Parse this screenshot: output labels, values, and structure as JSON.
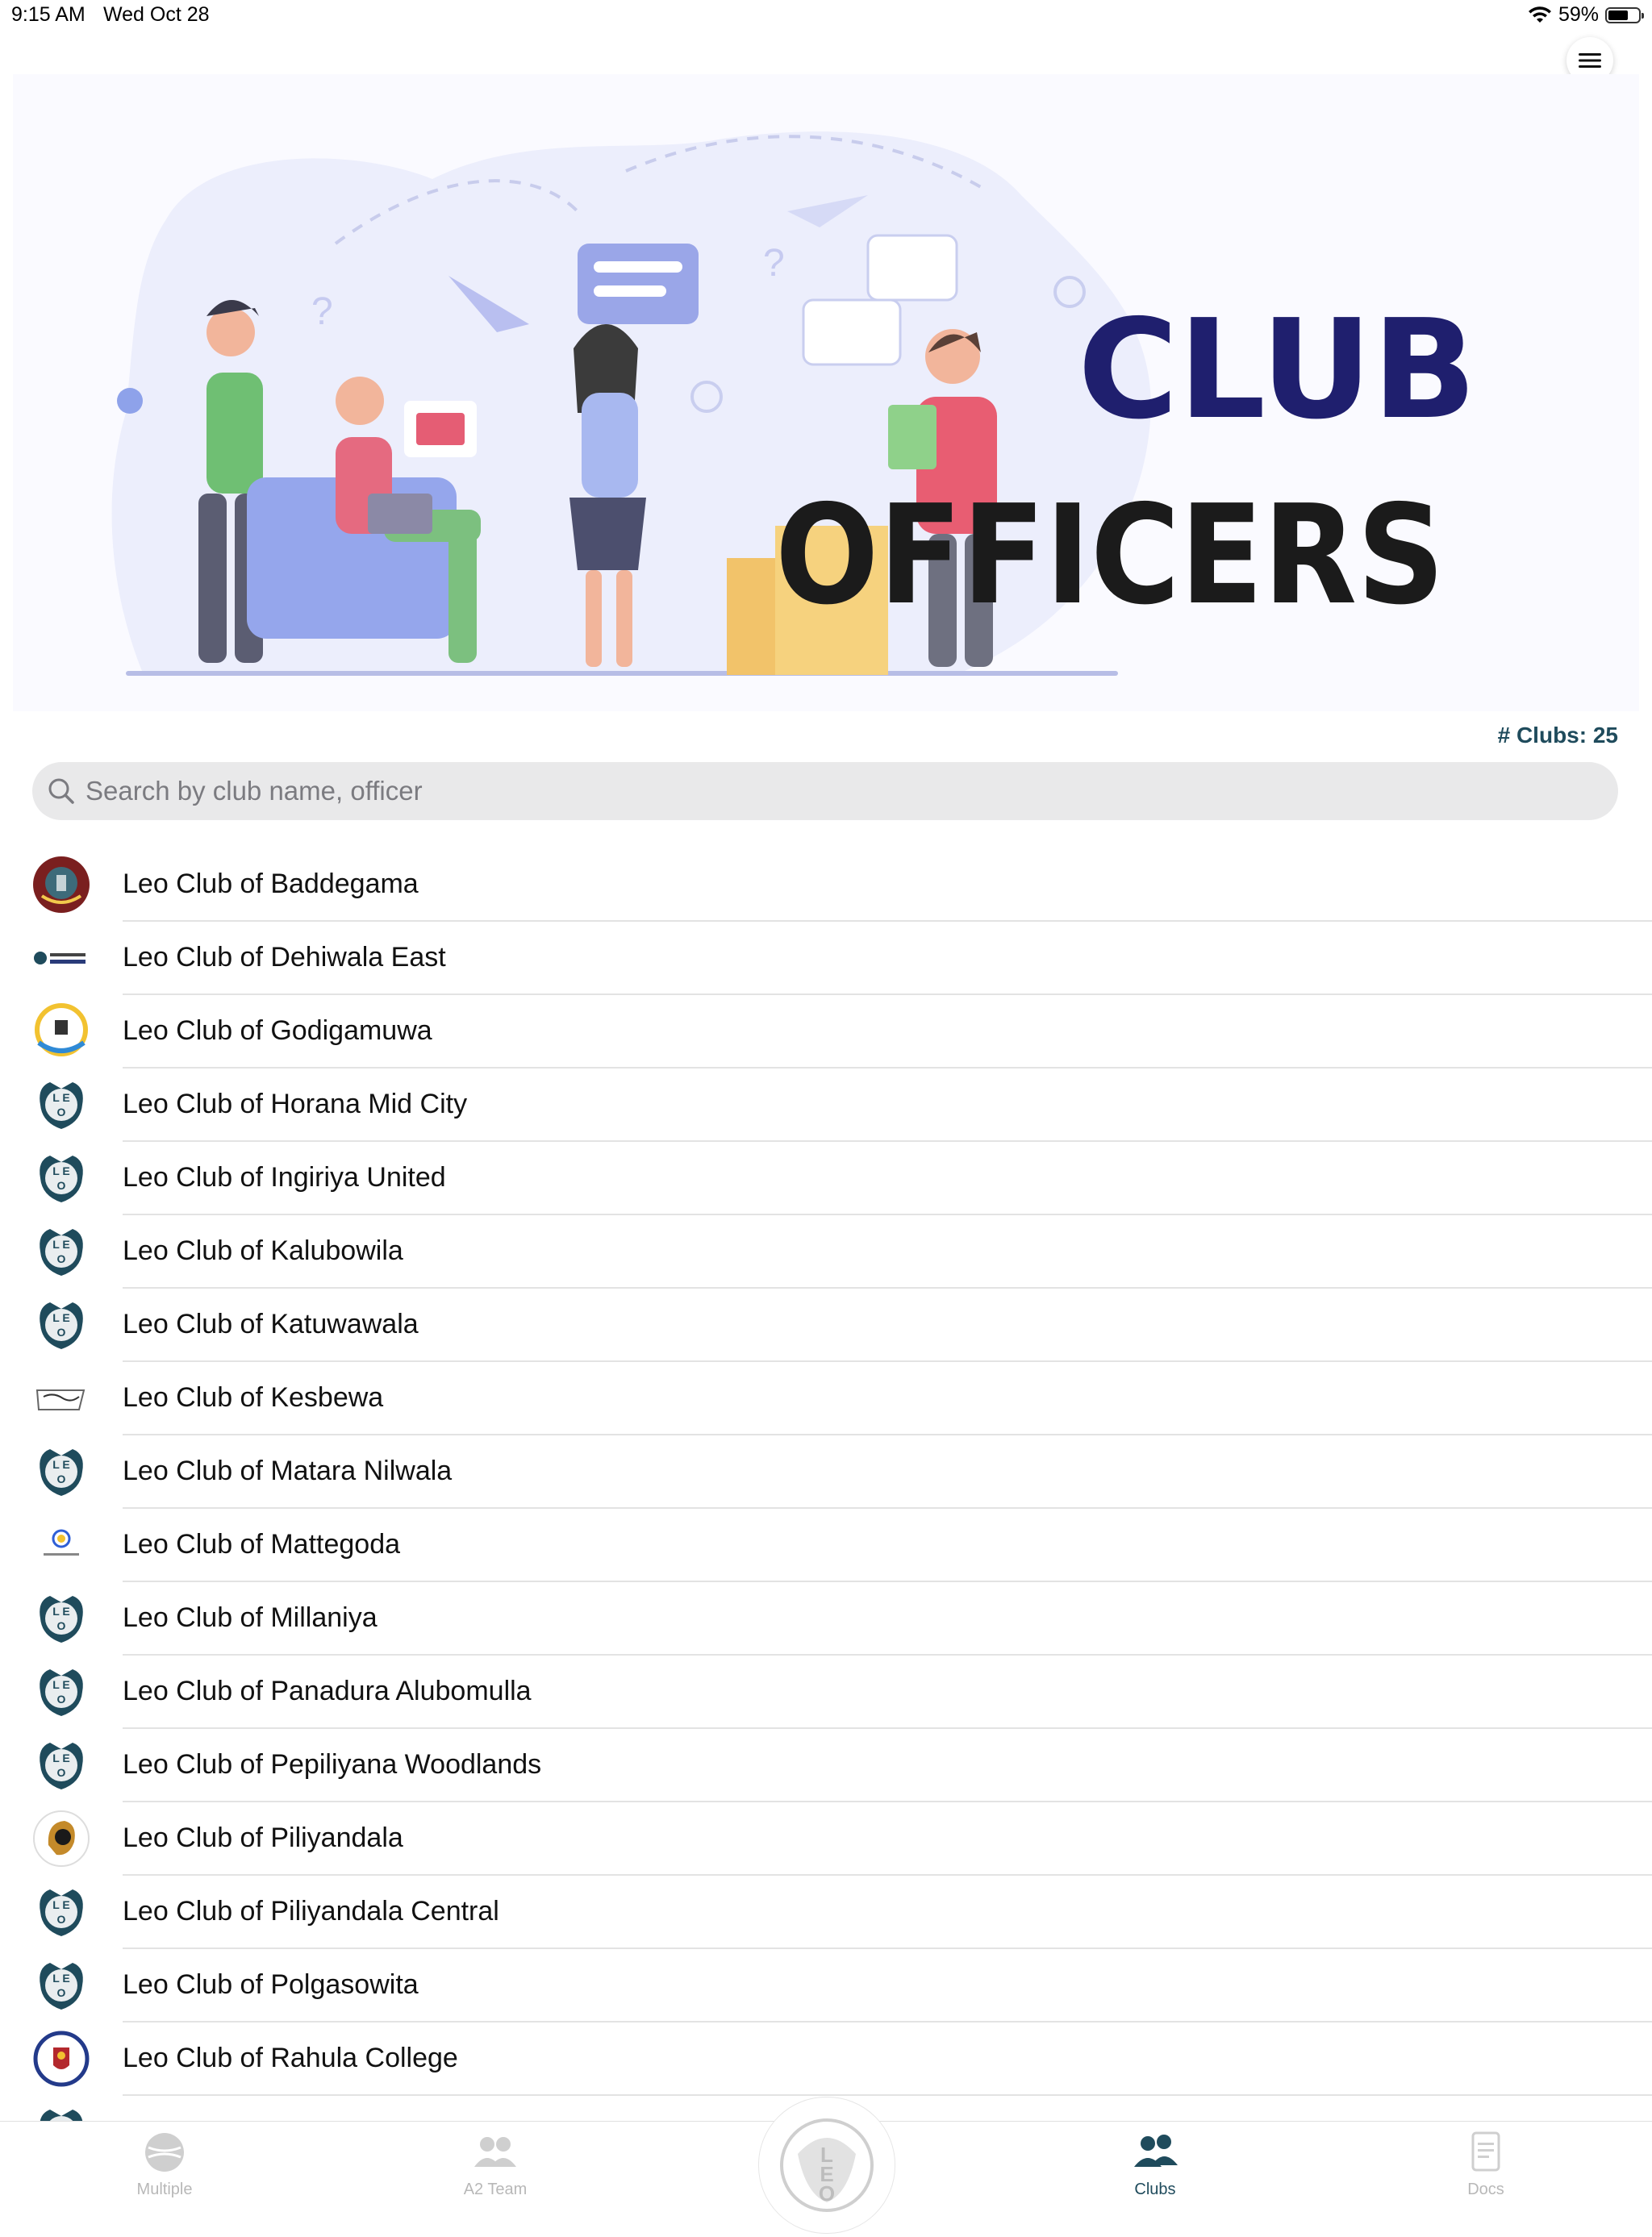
{
  "status_bar": {
    "time": "9:15 AM",
    "date": "Wed Oct 28",
    "battery": "59%",
    "battery_level": 0.59
  },
  "header": {
    "menu_icon": "hamburger-menu-icon"
  },
  "hero": {
    "title_line1": "CLUB",
    "title_line2": "OFFICERS"
  },
  "clubs_count": "# Clubs: 25",
  "search": {
    "placeholder": "Search by club name, officer"
  },
  "clubs": [
    {
      "name": "Leo Club of Baddegama",
      "logo": "maroon-crest-logo"
    },
    {
      "name": "Leo Club of Dehiwala East",
      "logo": "small-text-logo"
    },
    {
      "name": "Leo Club of Godigamuwa",
      "logo": "yellow-ring-logo"
    },
    {
      "name": "Leo Club of Horana Mid City",
      "logo": "leo-emblem-logo"
    },
    {
      "name": "Leo Club of Ingiriya United",
      "logo": "leo-emblem-logo"
    },
    {
      "name": "Leo Club of Kalubowila",
      "logo": "leo-emblem-logo"
    },
    {
      "name": "Leo Club of Katuwawala",
      "logo": "leo-emblem-logo"
    },
    {
      "name": "Leo Club of Kesbewa",
      "logo": "script-text-logo"
    },
    {
      "name": "Leo Club of Matara Nilwala",
      "logo": "leo-emblem-logo"
    },
    {
      "name": "Leo Club of Mattegoda",
      "logo": "small-round-logo"
    },
    {
      "name": "Leo Club of Millaniya",
      "logo": "leo-emblem-logo"
    },
    {
      "name": "Leo Club of Panadura Alubomulla",
      "logo": "leo-emblem-logo"
    },
    {
      "name": "Leo Club of Pepiliyana Woodlands",
      "logo": "leo-emblem-logo"
    },
    {
      "name": "Leo Club of Piliyandala",
      "logo": "lion-head-logo"
    },
    {
      "name": "Leo Club of Piliyandala Central",
      "logo": "leo-emblem-logo"
    },
    {
      "name": "Leo Club of Polgasowita",
      "logo": "leo-emblem-logo"
    },
    {
      "name": "Leo Club of Rahula College",
      "logo": "college-crest-logo"
    },
    {
      "name": "",
      "logo": "leo-emblem-logo"
    }
  ],
  "tabs": [
    {
      "label": "Multiple",
      "icon": "globe-icon",
      "active": false
    },
    {
      "label": "A2 Team",
      "icon": "team-icon",
      "active": false
    },
    {
      "label": "",
      "icon": "leo-center-icon",
      "active": false
    },
    {
      "label": "Clubs",
      "icon": "clubs-people-icon",
      "active": true
    },
    {
      "label": "Docs",
      "icon": "document-icon",
      "active": false
    }
  ],
  "colors": {
    "accent": "#1f4b5c",
    "title_navy": "#1f1f6e",
    "title_dark": "#1b1b1b",
    "search_bg": "#e9e9ea",
    "separator": "#e3e3e3",
    "inactive_tab": "#b8b8b8"
  }
}
